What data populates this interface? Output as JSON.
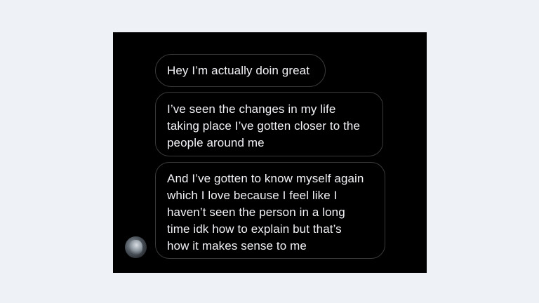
{
  "messages": [
    {
      "text": "Hey I’m actually doin great"
    },
    {
      "text": "I’ve seen the changes in my life\ntaking place I’ve gotten closer to the\npeople around me"
    },
    {
      "text": "And I’ve gotten to know myself again\nwhich I love because I feel like I\nhaven’t seen the person in a long\ntime idk how to explain but that’s\nhow it makes sense to me"
    }
  ],
  "colors": {
    "page_background": "#eef1f5",
    "chat_background": "#000000",
    "bubble_border": "#3a3a3c",
    "text": "#f2f2f7"
  },
  "icons": {
    "avatar": "sender-avatar"
  }
}
